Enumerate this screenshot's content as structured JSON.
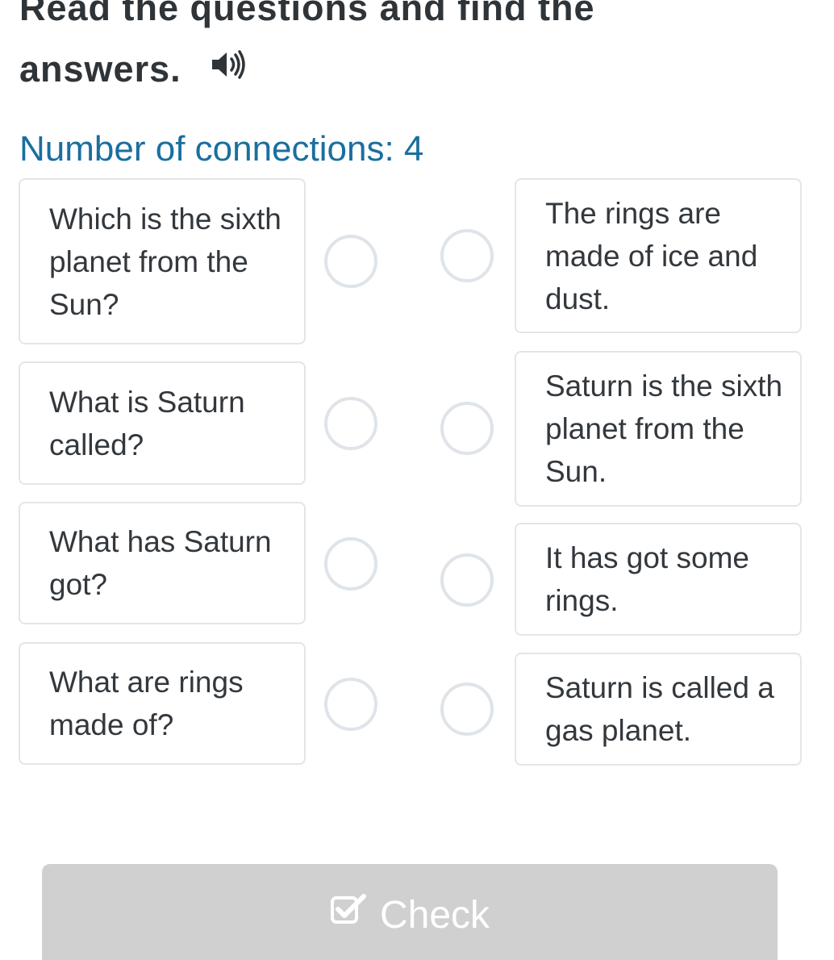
{
  "header": {
    "title": "Read the questions and find the answers."
  },
  "connections": {
    "text": "Number of connections: 4"
  },
  "questions": [
    {
      "text": "Which is the sixth planet from the Sun?"
    },
    {
      "text": "What is Saturn called?"
    },
    {
      "text": "What has Saturn got?"
    },
    {
      "text": "What are rings made of?"
    }
  ],
  "answers": [
    {
      "text": "The rings are made of ice and dust."
    },
    {
      "text": "Saturn is the sixth planet from the Sun."
    },
    {
      "text": "It has got some rings."
    },
    {
      "text": "Saturn is called a gas planet."
    }
  ],
  "check_button": {
    "label": "Check",
    "icon": "checkbox-check-icon"
  },
  "colors": {
    "heading": "#2f3438",
    "accent": "#1a6f9e",
    "card_border": "#e2e6ea",
    "button_disabled": "#d0d0d0"
  }
}
